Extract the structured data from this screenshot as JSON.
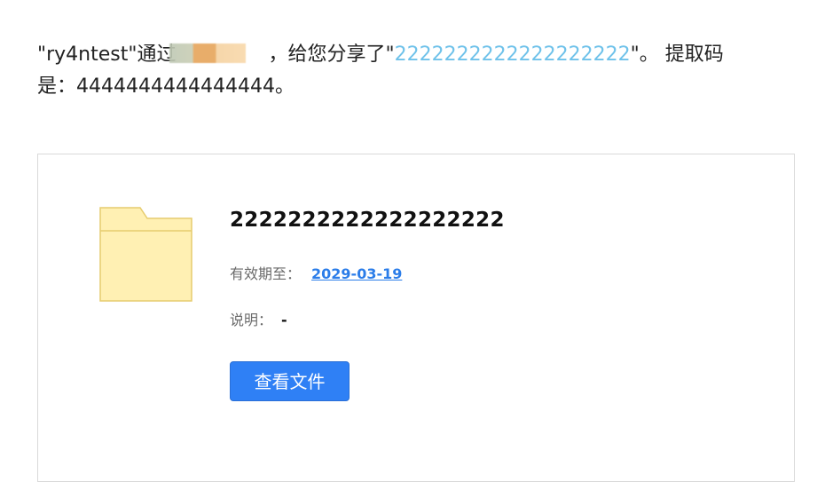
{
  "message": {
    "sender": "\"ry4ntest\"",
    "via_text": "通过",
    "shared_text": "，给您分享了\"",
    "link_text": "2222222222222222222",
    "after_link": "\"。 提取码",
    "code_line": "是：4444444444444444。"
  },
  "file": {
    "title": "2222222222222222222",
    "expiry_label": "有效期至：",
    "expiry_value": "2029-03-19",
    "desc_label": "说明：",
    "desc_value": "-",
    "view_button_label": "查看文件"
  },
  "colors": {
    "link": "#6fc2ea",
    "date_link": "#2b7de9",
    "button": "#2f80f5",
    "folder_fill": "#fff0b3",
    "folder_stroke": "#e6cc6e"
  },
  "icons": {
    "folder": "folder-icon"
  }
}
